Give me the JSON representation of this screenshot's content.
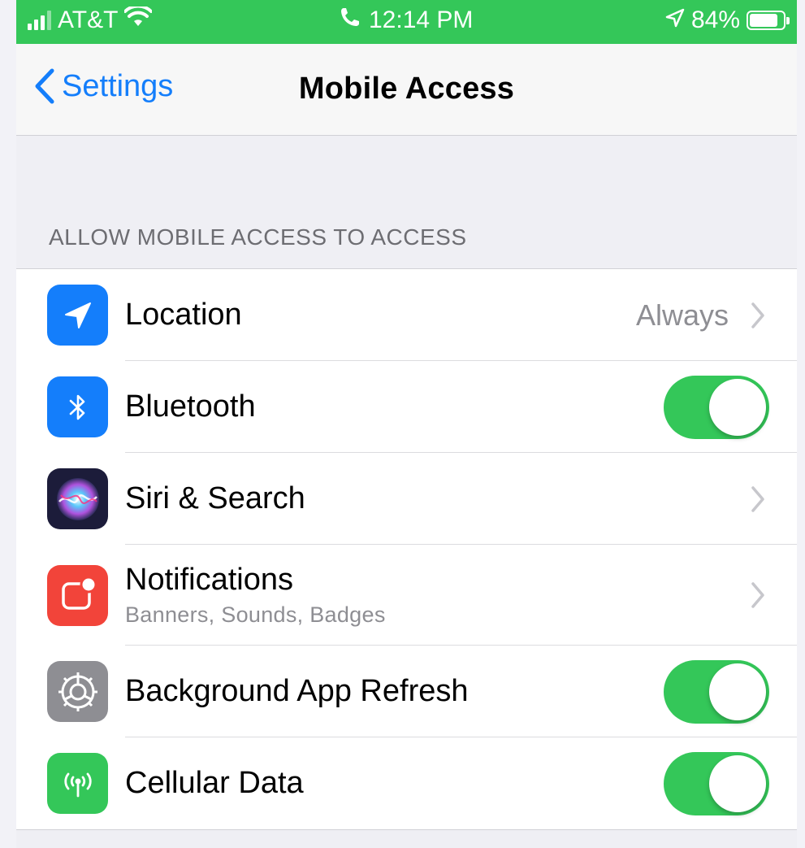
{
  "status_bar": {
    "carrier": "AT&T",
    "time": "12:14 PM",
    "battery": "84%",
    "battery_level": 0.84,
    "background_color": "#34c759"
  },
  "nav": {
    "back_label": "Settings",
    "title": "Mobile Access"
  },
  "section": {
    "header": "ALLOW MOBILE ACCESS TO ACCESS"
  },
  "rows": [
    {
      "label": "Location",
      "value": "Always",
      "icon": "location-arrow-icon",
      "icon_color": "#147efb",
      "accessory": "chevron"
    },
    {
      "label": "Bluetooth",
      "icon": "bluetooth-icon",
      "icon_color": "#147efb",
      "accessory": "toggle",
      "on": true
    },
    {
      "label": "Siri & Search",
      "icon": "siri-icon",
      "icon_color": "#1c1c3a",
      "accessory": "chevron"
    },
    {
      "label": "Notifications",
      "sublabel": "Banners, Sounds, Badges",
      "icon": "notifications-icon",
      "icon_color": "#f2443a",
      "accessory": "chevron"
    },
    {
      "label": "Background App Refresh",
      "icon": "gear-icon",
      "icon_color": "#8e8e93",
      "accessory": "toggle",
      "on": true
    },
    {
      "label": "Cellular Data",
      "icon": "cellular-antenna-icon",
      "icon_color": "#34c759",
      "accessory": "toggle",
      "on": true
    }
  ],
  "colors": {
    "accent": "#147efb",
    "toggle_on": "#34c759",
    "background": "#efeff4"
  }
}
